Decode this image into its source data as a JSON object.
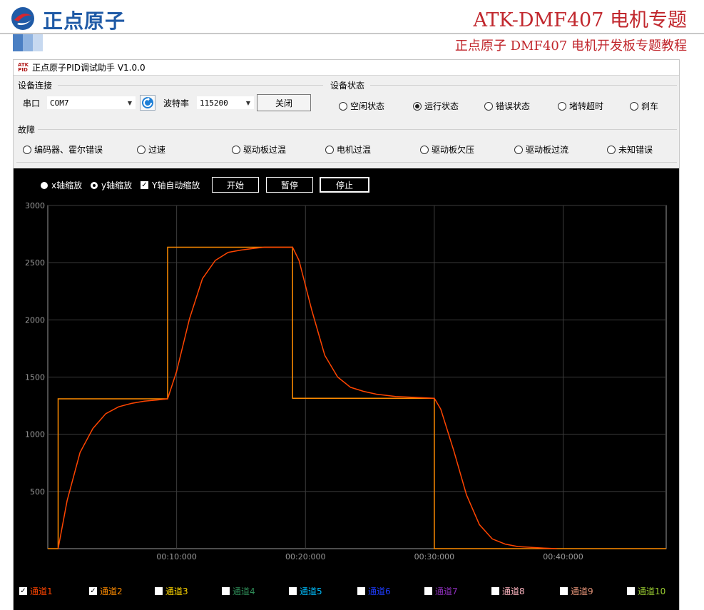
{
  "banner": {
    "logo_text": "正点原子",
    "title": "ATK-DMF407 电机专题",
    "subtitle": "正点原子 DMF407 电机开发板专题教程"
  },
  "window": {
    "app_icon": "ATK PID",
    "title": "正点原子PID调试助手 V1.0.0"
  },
  "connection": {
    "group_label": "设备连接",
    "port_label": "串口",
    "port_value": "COM7",
    "baud_label": "波特率",
    "baud_value": "115200",
    "close_button": "关闭"
  },
  "device_state": {
    "group_label": "设备状态",
    "options": [
      {
        "label": "空闲状态",
        "selected": false
      },
      {
        "label": "运行状态",
        "selected": true
      },
      {
        "label": "错误状态",
        "selected": false
      },
      {
        "label": "堵转超时",
        "selected": false
      },
      {
        "label": "刹车",
        "selected": false
      }
    ]
  },
  "fault": {
    "group_label": "故障",
    "options": [
      {
        "label": "编码器、霍尔错误"
      },
      {
        "label": "过速"
      },
      {
        "label": "驱动板过温"
      },
      {
        "label": "电机过温"
      },
      {
        "label": "驱动板欠压"
      },
      {
        "label": "驱动板过流"
      },
      {
        "label": "未知错误"
      }
    ]
  },
  "plot_controls": {
    "x_zoom": "x轴缩放",
    "y_zoom": "y轴缩放",
    "y_auto": "Y轴自动缩放",
    "start": "开始",
    "pause": "暂停",
    "stop": "停止"
  },
  "chart_data": {
    "type": "line",
    "xlabel": "",
    "ylabel": "",
    "ylim": [
      0,
      3000
    ],
    "xlim": [
      0,
      48
    ],
    "y_ticks": [
      500,
      1000,
      1500,
      2000,
      2500,
      3000
    ],
    "x_ticks": [
      10,
      20,
      30,
      40
    ],
    "x_tick_labels": [
      "00:10:000",
      "00:20:000",
      "00:30:000",
      "00:40:000"
    ],
    "grid": true,
    "series": [
      {
        "name": "通道2",
        "color": "#ff8c00",
        "x": [
          0,
          0.8,
          0.8,
          9.3,
          9.3,
          19.0,
          19.0,
          30.0,
          30.0,
          48
        ],
        "y": [
          0,
          0,
          1310,
          1310,
          2635,
          2635,
          1315,
          1315,
          0,
          0
        ]
      },
      {
        "name": "通道1",
        "color": "#ff4500",
        "x": [
          0.8,
          1.5,
          2.5,
          3.5,
          4.5,
          5.5,
          6.5,
          7.5,
          8.5,
          9.3,
          10.0,
          11.0,
          12.0,
          13.0,
          14.0,
          15.0,
          16.0,
          16.8,
          19.0,
          19.5,
          20.5,
          21.5,
          22.5,
          23.5,
          24.5,
          25.5,
          27.0,
          29.0,
          30.0,
          30.5,
          31.5,
          32.5,
          33.5,
          34.5,
          35.5,
          36.5,
          38.5,
          39.5
        ],
        "y": [
          0,
          420,
          840,
          1050,
          1180,
          1240,
          1270,
          1290,
          1300,
          1310,
          1550,
          2010,
          2360,
          2520,
          2590,
          2610,
          2625,
          2635,
          2635,
          2520,
          2080,
          1690,
          1500,
          1410,
          1375,
          1350,
          1330,
          1320,
          1315,
          1220,
          860,
          470,
          210,
          85,
          40,
          18,
          5,
          0
        ]
      }
    ]
  },
  "legend": [
    {
      "label": "通道1",
      "checked": true,
      "color": "#ff4500"
    },
    {
      "label": "通道2",
      "checked": true,
      "color": "#ff8c00"
    },
    {
      "label": "通道3",
      "checked": false,
      "color": "#ffd700"
    },
    {
      "label": "通道4",
      "checked": false,
      "color": "#2e8b57"
    },
    {
      "label": "通道5",
      "checked": false,
      "color": "#00bfff"
    },
    {
      "label": "通道6",
      "checked": false,
      "color": "#1e3cff"
    },
    {
      "label": "通道7",
      "checked": false,
      "color": "#8b2fb8"
    },
    {
      "label": "通道8",
      "checked": false,
      "color": "#ffb6c1"
    },
    {
      "label": "通道9",
      "checked": false,
      "color": "#e9967a"
    },
    {
      "label": "通道10",
      "checked": false,
      "color": "#9acd32"
    }
  ]
}
